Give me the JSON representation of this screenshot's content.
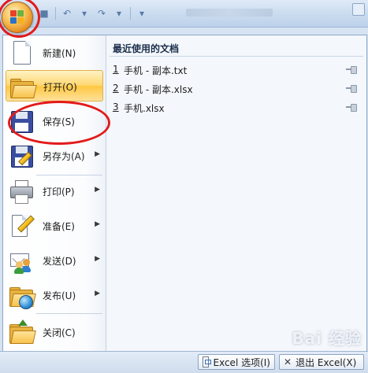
{
  "menu": {
    "items": [
      {
        "label": "新建(N)",
        "icon": "new-document-icon"
      },
      {
        "label": "打开(O)",
        "icon": "open-folder-icon"
      },
      {
        "label": "保存(S)",
        "icon": "floppy-disk-icon"
      },
      {
        "label": "另存为(A)",
        "icon": "save-as-icon"
      },
      {
        "label": "打印(P)",
        "icon": "printer-icon"
      },
      {
        "label": "准备(E)",
        "icon": "prepare-icon"
      },
      {
        "label": "发送(D)",
        "icon": "send-icon"
      },
      {
        "label": "发布(U)",
        "icon": "publish-icon"
      },
      {
        "label": "关闭(C)",
        "icon": "close-folder-icon"
      }
    ]
  },
  "recent": {
    "title": "最近使用的文档",
    "files": [
      {
        "num": "1",
        "name": "手机 - 副本.txt"
      },
      {
        "num": "2",
        "name": "手机 - 副本.xlsx"
      },
      {
        "num": "3",
        "name": "手机.xlsx"
      }
    ]
  },
  "bottom": {
    "options_label": "Excel 选项(I)",
    "exit_label": "退出 Excel(X)"
  },
  "watermark": "Bai 经验",
  "colors": {
    "active_highlight": "#ffd873",
    "annotation_ring": "#e21b1b",
    "panel_background": "#f4f7fb"
  }
}
